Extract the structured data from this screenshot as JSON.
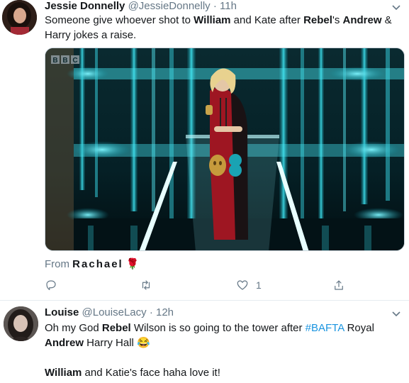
{
  "tweets": [
    {
      "name": "Jessie Donnelly",
      "handle": "@JessieDonnelly",
      "separator": "·",
      "time": "11h",
      "text": {
        "p1": "Someone give whoever shot to ",
        "b1": "William",
        "p2": " and Kate after ",
        "b2": "Rebel",
        "p3": "'s ",
        "b3": "Andrew",
        "p4": " & Harry jokes a raise."
      },
      "media": {
        "watermark": "BBC"
      },
      "from": {
        "prefix": "From",
        "name": "Rachael",
        "emoji": "🌹"
      },
      "actions": {
        "reply_count": "",
        "retweet_count": "",
        "like_count": "1"
      }
    },
    {
      "name": "Louise",
      "handle": "@LouiseLacy",
      "separator": "·",
      "time": "12h",
      "text": {
        "p1": "Oh my God ",
        "b1": "Rebel",
        "p2": " Wilson is so going to the tower after ",
        "hashtag": "#BAFTA",
        "p3": " Royal ",
        "b2": "Andrew",
        "p4": " Harry Hall ",
        "emoji": "😂",
        "line2_b": "William",
        "line2_p": " and Katie's face haha love it!"
      }
    }
  ],
  "colors": {
    "link": "#1b95e0",
    "secondary": "#657786",
    "primary_text": "#14171a",
    "divider": "#e6ecf0"
  },
  "icons": [
    "reply-icon",
    "retweet-icon",
    "like-icon",
    "share-icon",
    "chevron-down-icon"
  ]
}
